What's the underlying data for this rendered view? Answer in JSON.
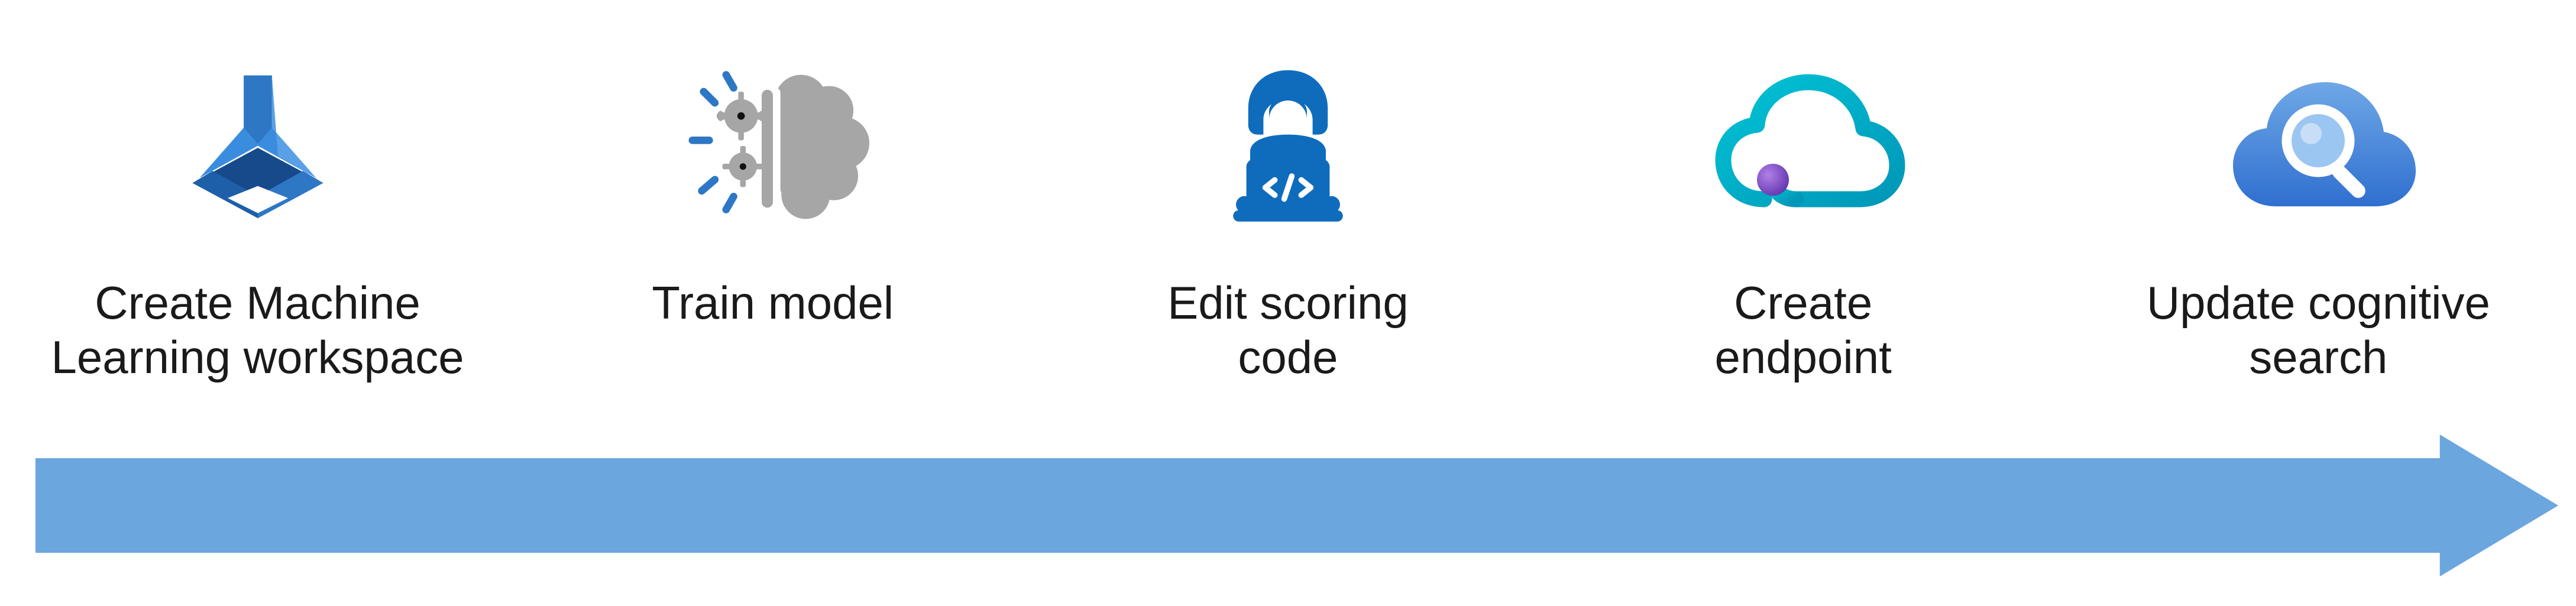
{
  "diagram": {
    "type": "process-flow",
    "direction": "left-to-right",
    "arrow_color": "#6CA6DF",
    "steps": [
      {
        "id": "create-ml-workspace",
        "label": "Create Machine\nLearning workspace",
        "icon": "azure-ml-icon"
      },
      {
        "id": "train-model",
        "label": "Train model",
        "icon": "brain-gear-icon"
      },
      {
        "id": "edit-scoring-code",
        "label": "Edit scoring\ncode",
        "icon": "developer-laptop-icon"
      },
      {
        "id": "create-endpoint",
        "label": "Create\nendpoint",
        "icon": "cloud-endpoint-icon"
      },
      {
        "id": "update-cognitive-search",
        "label": "Update cognitive\nsearch",
        "icon": "cognitive-search-icon"
      }
    ]
  },
  "colors": {
    "azure_blue": "#0F6CBD",
    "azure_dark": "#174A8B",
    "grey": "#A6A6A6",
    "teal": "#00B7C3",
    "purple": "#7B3FBF",
    "sky": "#6CA6DF",
    "cloud_blue_light": "#6FA8E6",
    "cloud_blue_dark": "#2F6FD0",
    "text": "#1a1a1a"
  }
}
